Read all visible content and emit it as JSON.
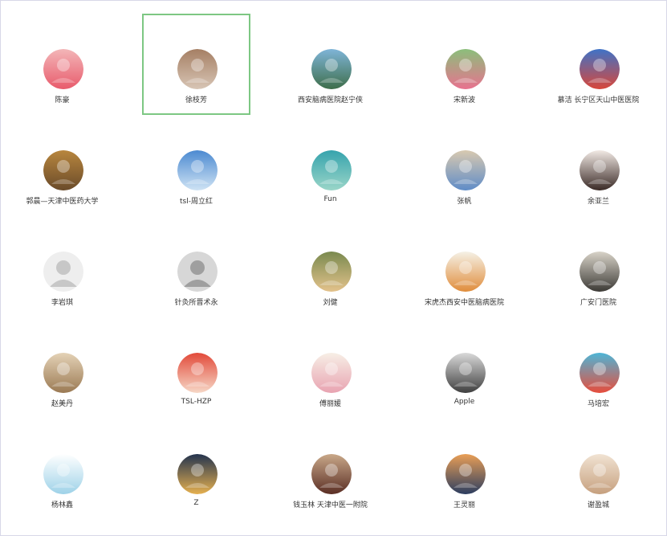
{
  "contacts": [
    {
      "name": "陈豪",
      "icon": "cartoon-girl-avatar",
      "colors": [
        "#f3b6b8",
        "#e85b6c"
      ]
    },
    {
      "name": "徐枝芳",
      "icon": "room-photo-avatar",
      "colors": [
        "#a57f64",
        "#d7c5b5"
      ],
      "selected": true
    },
    {
      "name": "西安脑病医院赵宁侠",
      "icon": "landscape-avatar",
      "colors": [
        "#7fb5d8",
        "#3e6e4a"
      ]
    },
    {
      "name": "宋新波",
      "icon": "lotus-avatar",
      "colors": [
        "#8bbf7b",
        "#e8728f"
      ]
    },
    {
      "name": "慕洁 长宁区天山中医医院",
      "icon": "sailboat-avatar",
      "colors": [
        "#3f73c7",
        "#d8473a"
      ]
    },
    {
      "name": "郭晨—天津中医药大学",
      "icon": "great-wall-avatar",
      "colors": [
        "#b8863e",
        "#6a4b2a"
      ]
    },
    {
      "name": "tsl-周立红",
      "icon": "sky-avatar",
      "colors": [
        "#4c8ad1",
        "#cfe3f4"
      ]
    },
    {
      "name": "Fun",
      "icon": "sheep-avatar",
      "colors": [
        "#36a3ad",
        "#9ad5c8"
      ]
    },
    {
      "name": "张帆",
      "icon": "bear-toy-avatar",
      "colors": [
        "#d8c9b0",
        "#5f8cc7"
      ]
    },
    {
      "name": "余亚兰",
      "icon": "drawn-girl-avatar",
      "colors": [
        "#f1e9e4",
        "#3a2a26"
      ]
    },
    {
      "name": "李岩琪",
      "icon": "default-person-icon",
      "colors": [
        "#eeeeee",
        "#c7c7c7"
      ]
    },
    {
      "name": "针灸所晋术永",
      "icon": "silhouette-person-icon",
      "colors": [
        "#d7d7d7",
        "#9f9f9f"
      ]
    },
    {
      "name": "刘健",
      "icon": "kids-photo-avatar",
      "colors": [
        "#7a8a4f",
        "#e3c28b"
      ]
    },
    {
      "name": "宋虎杰西安中医脑病医院",
      "icon": "tiger-cartoon-avatar",
      "colors": [
        "#f5f1e6",
        "#e08d3c"
      ]
    },
    {
      "name": "广安门医院",
      "icon": "bird-painting-avatar",
      "colors": [
        "#d8d3c8",
        "#3c3a36"
      ]
    },
    {
      "name": "赵美丹",
      "icon": "cat-avatar",
      "colors": [
        "#e4d2b6",
        "#9b7a54"
      ]
    },
    {
      "name": "TSL-HZP",
      "icon": "red-girl-avatar",
      "colors": [
        "#e24a3a",
        "#f6d7c6"
      ]
    },
    {
      "name": "傅丽媛",
      "icon": "tree-avatar",
      "colors": [
        "#f7efe6",
        "#e8a3b1"
      ]
    },
    {
      "name": "Apple",
      "icon": "lake-photo-avatar",
      "colors": [
        "#d9d9d9",
        "#3f3f3f"
      ]
    },
    {
      "name": "马培宏",
      "icon": "boy-cartoon-avatar",
      "colors": [
        "#4eb5d6",
        "#e74d3c"
      ]
    },
    {
      "name": "杨林鑫",
      "icon": "ghost-cat-avatar",
      "colors": [
        "#ffffff",
        "#9ed2e8"
      ]
    },
    {
      "name": "Z",
      "icon": "city-night-avatar",
      "colors": [
        "#24344f",
        "#e5b04f"
      ]
    },
    {
      "name": "钱玉林 天津中医一附院",
      "icon": "man-toy-avatar",
      "colors": [
        "#c9a889",
        "#5a2e24"
      ]
    },
    {
      "name": "王灵丽",
      "icon": "sunset-person-avatar",
      "colors": [
        "#e99f56",
        "#2c3d60"
      ]
    },
    {
      "name": "谢盈城",
      "icon": "window-room-avatar",
      "colors": [
        "#f1e3d3",
        "#c6a07e"
      ]
    }
  ]
}
